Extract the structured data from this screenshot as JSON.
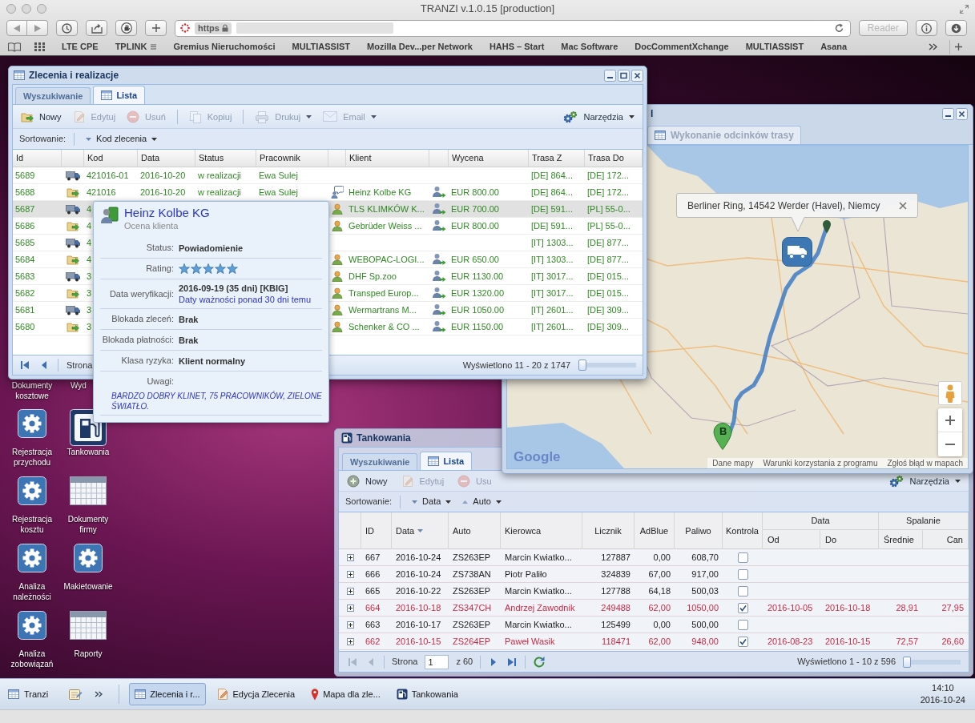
{
  "browser": {
    "title": "TRANZI v.1.0.15 [production]",
    "address": {
      "scheme": "https"
    },
    "reader_button": {
      "label": "Reader",
      "disabled": true
    },
    "bookmarks": [
      {
        "kind": "link",
        "label": "LTE CPE"
      },
      {
        "kind": "folder",
        "label": "TPLINK"
      },
      {
        "kind": "link",
        "label": "Gremius Nieruchomości"
      },
      {
        "kind": "link",
        "label": "MULTIASSIST"
      },
      {
        "kind": "link",
        "label": "Mozilla Dev...per Network"
      },
      {
        "kind": "link",
        "label": "HAHS – Start"
      },
      {
        "kind": "link",
        "label": "Mac Software"
      },
      {
        "kind": "link",
        "label": "DocCommentXchange"
      },
      {
        "kind": "link",
        "label": "MULTIASSIST"
      },
      {
        "kind": "link",
        "label": "Asana"
      }
    ]
  },
  "orders_window": {
    "title": "Zlecenia i realizacje",
    "tabs": [
      {
        "kind": "plain",
        "label": "Wyszukiwanie",
        "selected": false
      },
      {
        "kind": "table",
        "label": "Lista",
        "selected": true
      }
    ],
    "toolbar": [
      {
        "kind": "new",
        "label": "Nowy",
        "disabled": false
      },
      {
        "kind": "edit",
        "label": "Edytuj",
        "disabled": true
      },
      {
        "kind": "delete",
        "label": "Usuń",
        "disabled": true
      },
      {
        "kind": "separator"
      },
      {
        "kind": "copy",
        "label": "Kopiuj",
        "disabled": true
      },
      {
        "kind": "separator"
      },
      {
        "kind": "print",
        "label": "Drukuj",
        "disabled": true,
        "menu": true
      },
      {
        "kind": "email",
        "label": "Email",
        "disabled": true,
        "menu": true
      },
      {
        "kind": "tools",
        "label": "Narzędzia",
        "disabled": false,
        "menu": true
      }
    ],
    "sort_bar": {
      "label": "Sortowanie:",
      "sorters": [
        {
          "label": "Kod zlecenia",
          "descending": true
        }
      ]
    },
    "grid": {
      "columns": [
        {
          "kind": "text",
          "label": "Id"
        },
        {
          "kind": "icon"
        },
        {
          "kind": "text",
          "label": "Kod"
        },
        {
          "kind": "text",
          "label": "Data"
        },
        {
          "kind": "text",
          "label": "Status"
        },
        {
          "kind": "text",
          "label": "Pracownik"
        },
        {
          "kind": "icon"
        },
        {
          "kind": "text",
          "label": "Klient"
        },
        {
          "kind": "icon"
        },
        {
          "kind": "text",
          "label": "Wycena"
        },
        {
          "kind": "text",
          "label": "Trasa Z"
        },
        {
          "kind": "text",
          "label": "Trasa Do"
        }
      ],
      "rows": [
        {
          "id": "5689",
          "column_2": {
            "kind": "truck"
          },
          "kod": "421016-01",
          "data": "2016-10-20",
          "status": "w realizacji",
          "pracownik": "Ewa Sulej",
          "trasa_z": "[DE] 864...",
          "trasa_do": "[DE] 172...",
          "selected": false
        },
        {
          "id": "5688",
          "column_2": {
            "kind": "folder"
          },
          "kod": "421016",
          "data": "2016-10-20",
          "status": "w realizacji",
          "pracownik": "Ewa Sulej",
          "column_7": {
            "kind": "comment"
          },
          "klient": "Heinz Kolbe KG",
          "column_9": {
            "kind": "person"
          },
          "wycena": "EUR 800.00",
          "trasa_z": "[DE] 864...",
          "trasa_do": "[DE] 172...",
          "selected": false
        },
        {
          "id": "5687",
          "column_2": {
            "kind": "truck"
          },
          "kod": "4",
          "column_7": {
            "kind": "person"
          },
          "klient": "TLS KLIMKÓW K...",
          "column_9": {
            "kind": "person"
          },
          "wycena": "EUR 700.00",
          "trasa_z": "[DE] 591...",
          "trasa_do": "[PL] 55-0...",
          "selected": true
        },
        {
          "id": "5686",
          "column_2": {
            "kind": "folder"
          },
          "kod": "4",
          "column_7": {
            "kind": "person"
          },
          "klient": "Gebrüder Weiss ...",
          "column_9": {
            "kind": "person"
          },
          "wycena": "EUR 800.00",
          "trasa_z": "[DE] 591...",
          "trasa_do": "[PL] 55-0...",
          "selected": false
        },
        {
          "id": "5685",
          "column_2": {
            "kind": "truck"
          },
          "kod": "4",
          "trasa_z": "[IT] 1303...",
          "trasa_do": "[DE] 877...",
          "selected": false
        },
        {
          "id": "5684",
          "column_2": {
            "kind": "folder"
          },
          "kod": "4",
          "column_7": {
            "kind": "person"
          },
          "klient": "WEBOPAC-LOGI...",
          "column_9": {
            "kind": "person"
          },
          "wycena": "EUR 650.00",
          "trasa_z": "[IT] 1303...",
          "trasa_do": "[DE] 877...",
          "selected": false
        },
        {
          "id": "5683",
          "column_2": {
            "kind": "truck"
          },
          "kod": "3",
          "column_7": {
            "kind": "person"
          },
          "klient": "DHF Sp.zoo",
          "column_9": {
            "kind": "person"
          },
          "wycena": "EUR 1130.00",
          "trasa_z": "[IT] 3017...",
          "trasa_do": "[DE] 015...",
          "selected": false
        },
        {
          "id": "5682",
          "column_2": {
            "kind": "folder"
          },
          "kod": "3",
          "column_7": {
            "kind": "person"
          },
          "klient": "Transped Europ...",
          "column_9": {
            "kind": "person"
          },
          "wycena": "EUR 1320.00",
          "trasa_z": "[IT] 3017...",
          "trasa_do": "[DE] 015...",
          "selected": false
        },
        {
          "id": "5681",
          "column_2": {
            "kind": "truck"
          },
          "kod": "3",
          "column_7": {
            "kind": "person"
          },
          "klient": "Wermartrans M...",
          "column_9": {
            "kind": "person"
          },
          "wycena": "EUR 1050.00",
          "trasa_z": "[IT] 2601...",
          "trasa_do": "[DE] 309...",
          "selected": false
        },
        {
          "id": "5680",
          "column_2": {
            "kind": "folder"
          },
          "kod": "3",
          "column_7": {
            "kind": "person"
          },
          "klient": "Schenker & CO ...",
          "column_9": {
            "kind": "person"
          },
          "wycena": "EUR 1150.00",
          "trasa_z": "[IT] 2601...",
          "trasa_do": "[DE] 309...",
          "selected": false
        }
      ]
    },
    "paging": {
      "nav_buttons": [
        {
          "kind": "first",
          "disabled": false
        },
        {
          "kind": "prev",
          "disabled": false
        }
      ],
      "page_label": "Strona",
      "info": "Wyświetlono 11 - 20 z 1747",
      "slider": {
        "level": 0
      }
    }
  },
  "client_tooltip": {
    "title": "Heinz Kolbe KG",
    "subtitle": "Ocena klienta",
    "fields": [
      {
        "kind": "text",
        "label": "Status:",
        "value": "Powiadomienie"
      },
      {
        "kind": "stars",
        "label": "Rating:",
        "stars": 5
      },
      {
        "kind": "text",
        "label": "Data weryfikacji:",
        "value": "2016-09-19 (35 dni) [KBIG]",
        "note": "Daty ważności ponad 30 dni temu"
      },
      {
        "kind": "text",
        "label": "Blokada zleceń:",
        "value": "Brak"
      },
      {
        "kind": "text",
        "label": "Blokada płatności:",
        "value": "Brak"
      },
      {
        "kind": "text",
        "label": "Klasa ryzyka:",
        "value": "Klient normalny"
      },
      {
        "kind": "remark",
        "label": "Uwagi:",
        "note": "BARDZO DOBRY KLINET, 75 PRACOWNIKÓW, ZIELONE ŚWIATŁO."
      }
    ]
  },
  "map_window": {
    "title": "l",
    "tab": {
      "label": "Wykonanie odcinków trasy"
    },
    "info_window": {
      "text": "Berliner Ring, 14542 Werder (Havel), Niemcy"
    },
    "marker_label": "B",
    "logo": "Google",
    "attribution": [
      "Dane mapy",
      "Warunki korzystania z programu",
      "Zgłoś błąd w mapach"
    ]
  },
  "desktop": {
    "shortcuts": [
      {
        "kind": "covered",
        "label": "Dokumenty kosztowe"
      },
      {
        "kind": "covered",
        "label": "Wyd"
      },
      {
        "kind": "gear",
        "label": "Rejestracja przychodu"
      },
      {
        "kind": "fuel",
        "label": "Tankowania"
      },
      {
        "kind": "gear",
        "label": "Rejestracja kosztu"
      },
      {
        "kind": "calendar",
        "label": "Dokumenty firmy"
      },
      {
        "kind": "gear",
        "label": "Analiza należności"
      },
      {
        "kind": "gear",
        "label": "Makietowanie"
      },
      {
        "kind": "gear",
        "label": "Analiza zobowiązań"
      },
      {
        "kind": "calendar",
        "label": "Raporty"
      }
    ]
  },
  "fuel_window": {
    "title": "Tankowania",
    "tabs": [
      {
        "kind": "plain",
        "label": "Wyszukiwanie",
        "selected": false
      },
      {
        "kind": "table",
        "label": "Lista",
        "selected": true
      }
    ],
    "toolbar": [
      {
        "kind": "add",
        "label": "Nowy",
        "disabled": false
      },
      {
        "kind": "edit",
        "label": "Edytuj",
        "disabled": true
      },
      {
        "kind": "delete",
        "label": "Usu",
        "disabled": true
      },
      {
        "kind": "tools",
        "label": "Narzędzia",
        "disabled": false,
        "menu": true
      }
    ],
    "sort_bar": {
      "label": "Sortowanie:",
      "sorters": [
        {
          "label": "Data",
          "descending": true
        },
        {
          "label": "Auto",
          "descending": false
        }
      ]
    },
    "grid": {
      "columns": [
        {
          "kind": "expander"
        },
        {
          "kind": "text",
          "label": "ID"
        },
        {
          "kind": "text",
          "label": "Data",
          "sorted": true,
          "descending": true
        },
        {
          "kind": "text",
          "label": "Auto"
        },
        {
          "kind": "text",
          "label": "Kierowca"
        },
        {
          "kind": "text",
          "label": "Licznik"
        },
        {
          "kind": "text",
          "label": "AdBlue"
        },
        {
          "kind": "text",
          "label": "Paliwo"
        },
        {
          "kind": "text",
          "label": "Kontrola"
        },
        {
          "kind": "group",
          "label": "Data",
          "children": [
            {
              "label": "Od"
            },
            {
              "label": "Do"
            }
          ]
        },
        {
          "kind": "group",
          "label": "Spalanie",
          "children": [
            {
              "label": "Średnie"
            },
            {
              "label": "Can"
            }
          ]
        }
      ],
      "rows": [
        {
          "expanded": false,
          "id": "667",
          "data": "2016-10-24",
          "auto": "ZS263EP",
          "kierowca": "Marcin Kwiatko...",
          "licznik": "127887",
          "adblue": "0,00",
          "paliwo": "608,70",
          "kontrola": false
        },
        {
          "expanded": false,
          "id": "666",
          "data": "2016-10-24",
          "auto": "ZS738AN",
          "kierowca": "Piotr Paliło",
          "licznik": "324839",
          "adblue": "67,00",
          "paliwo": "917,00",
          "kontrola": false
        },
        {
          "expanded": false,
          "id": "665",
          "data": "2016-10-22",
          "auto": "ZS263EP",
          "kierowca": "Marcin Kwiatko...",
          "licznik": "127788",
          "adblue": "64,18",
          "paliwo": "500,03",
          "kontrola": false
        },
        {
          "expanded": false,
          "id": "664",
          "data": "2016-10-18",
          "auto": "ZS347CH",
          "kierowca": "Andrzej Zawodnik",
          "licznik": "249488",
          "adblue": "62,00",
          "paliwo": "1050,00",
          "kontrola": true,
          "od": "2016-10-05",
          "do": "2016-10-18",
          "srednie": "28,91",
          "can": "27,95"
        },
        {
          "expanded": false,
          "id": "663",
          "data": "2016-10-17",
          "auto": "ZS263EP",
          "kierowca": "Marcin Kwiatko...",
          "licznik": "125499",
          "adblue": "0,00",
          "paliwo": "500,00",
          "kontrola": false
        },
        {
          "expanded": false,
          "id": "662",
          "data": "2016-10-15",
          "auto": "ZS264EP",
          "kierowca": "Paweł Wasik",
          "licznik": "118471",
          "adblue": "62,00",
          "paliwo": "948,00",
          "kontrola": true,
          "od": "2016-08-23",
          "do": "2016-10-15",
          "srednie": "72,57",
          "can": "26,60"
        }
      ]
    },
    "paging": {
      "nav_buttons": [
        {
          "kind": "first",
          "disabled": true
        },
        {
          "kind": "prev",
          "disabled": true
        },
        {
          "kind": "next",
          "disabled": false
        },
        {
          "kind": "last",
          "disabled": false
        },
        {
          "kind": "refresh",
          "disabled": false
        }
      ],
      "page_label": "Strona",
      "page": "1",
      "page_total": "z 60",
      "info": "Wyświetlono 1 - 10 z 596",
      "slider": {
        "level": 0
      }
    }
  },
  "taskbar": {
    "start_button": {
      "label": "Tranzi"
    },
    "tasks": [
      {
        "kind": "table",
        "label": "Zlecenia i r...",
        "selected": true
      },
      {
        "kind": "edit",
        "label": "Edycja Zlecenia",
        "selected": false
      },
      {
        "kind": "pin",
        "label": "Mapa dla zle...",
        "selected": false
      },
      {
        "kind": "fuel",
        "label": "Tankowania",
        "selected": false
      }
    ],
    "clock": {
      "time": "14:10",
      "date": "2016-10-24"
    }
  }
}
